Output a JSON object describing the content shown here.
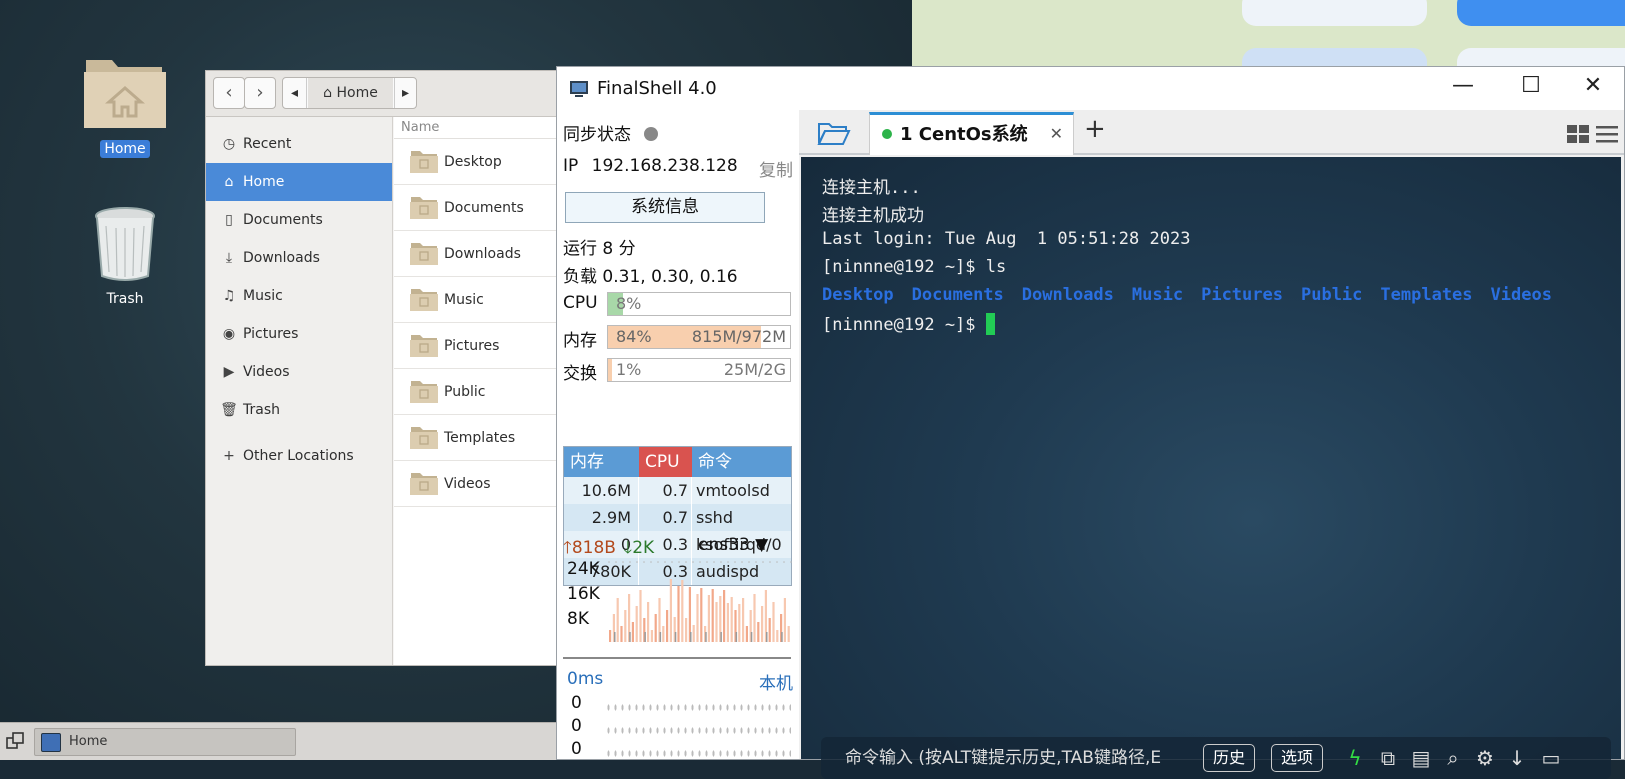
{
  "desktop": {
    "icons": [
      {
        "label": "Home"
      },
      {
        "label": "Trash"
      }
    ]
  },
  "files_window": {
    "path_bar": {
      "location": "Home"
    },
    "sidebar": [
      {
        "label": "Recent",
        "icon": "clock-icon"
      },
      {
        "label": "Home",
        "icon": "home-icon",
        "active": true
      },
      {
        "label": "Documents",
        "icon": "document-icon"
      },
      {
        "label": "Downloads",
        "icon": "download-icon"
      },
      {
        "label": "Music",
        "icon": "music-icon"
      },
      {
        "label": "Pictures",
        "icon": "camera-icon"
      },
      {
        "label": "Videos",
        "icon": "video-icon"
      },
      {
        "label": "Trash",
        "icon": "trash-icon"
      },
      {
        "label": "Other Locations",
        "icon": "plus-icon"
      }
    ],
    "column_header": "Name",
    "files": [
      "Desktop",
      "Documents",
      "Downloads",
      "Music",
      "Pictures",
      "Public",
      "Templates",
      "Videos"
    ]
  },
  "taskbar": {
    "window_label": "Home"
  },
  "finalshell": {
    "title": "FinalShell 4.0",
    "sync_label": "同步状态",
    "ip_label": "IP",
    "ip_value": "192.168.238.128",
    "copy_label": "复制",
    "sysinfo_button": "系统信息",
    "uptime": "运行 8 分",
    "load": "负载 0.31, 0.30, 0.16",
    "cpu": {
      "label": "CPU",
      "value": "8%",
      "fraction": 0.08
    },
    "mem": {
      "label": "内存",
      "value": "84%",
      "detail": "815M/972M",
      "fraction": 0.84
    },
    "swap": {
      "label": "交换",
      "value": "1%",
      "detail": "25M/2G",
      "fraction": 0.01
    },
    "proc_headers": [
      "内存",
      "CPU",
      "命令"
    ],
    "processes": [
      [
        "10.6M",
        "0.7",
        "vmtoolsd"
      ],
      [
        "2.9M",
        "0.7",
        "sshd"
      ],
      [
        "0",
        "0.3",
        "ksoftirqd/0"
      ],
      [
        "780K",
        "0.3",
        "audispd"
      ]
    ],
    "net": {
      "up": "818B",
      "down": "2K",
      "iface": "ens33",
      "y_ticks": [
        "24K",
        "16K",
        "8K"
      ]
    },
    "ping": {
      "latency": "0ms",
      "host": "本机",
      "values": [
        "0",
        "0",
        "0"
      ]
    },
    "tab": {
      "label": "1 CentOs系统"
    },
    "terminal_lines": [
      "连接主机...",
      "连接主机成功",
      "Last login: Tue Aug  1 05:51:28 2023",
      "[ninnne@192 ~]$ ls"
    ],
    "ls_output": [
      "Desktop",
      "Documents",
      "Downloads",
      "Music",
      "Pictures",
      "Public",
      "Templates",
      "Videos"
    ],
    "prompt": "[ninnne@192 ~]$ ",
    "command_bar": {
      "placeholder": "命令输入 (按ALT键提示历史,TAB键路径,E",
      "history_button": "历史",
      "options_button": "选项"
    }
  }
}
